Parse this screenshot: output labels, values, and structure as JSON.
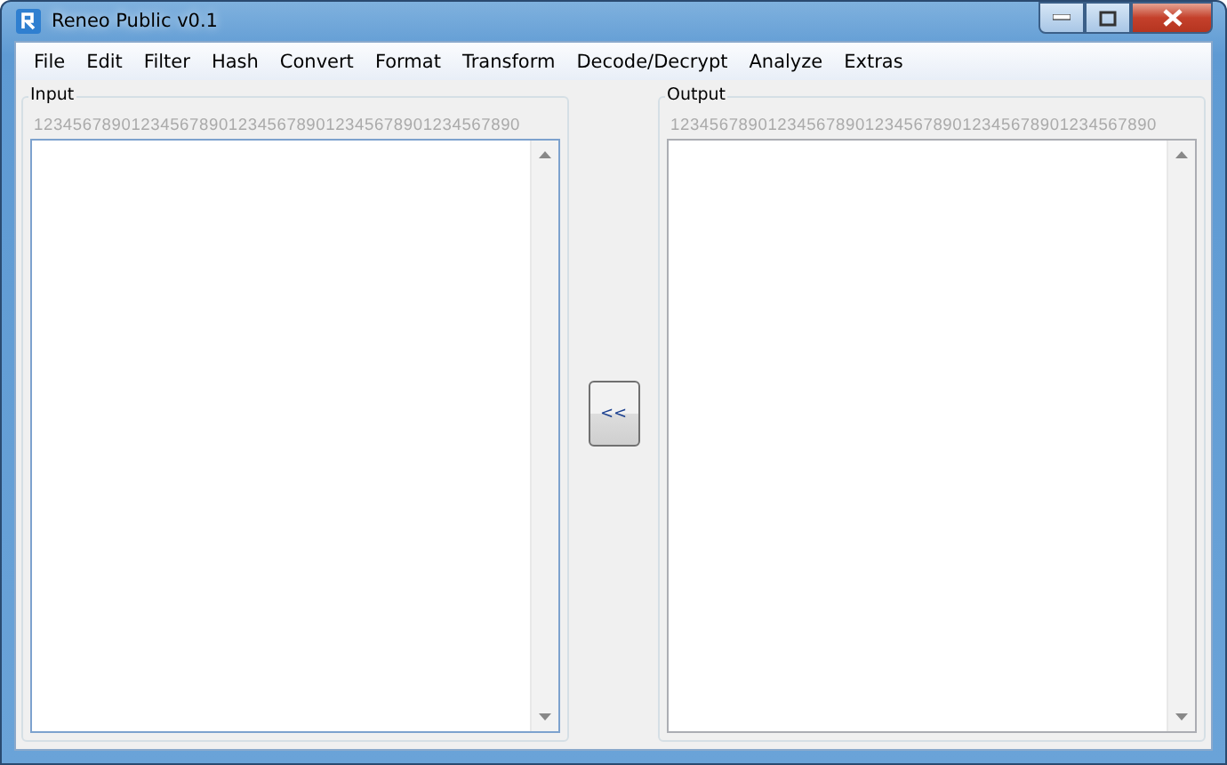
{
  "window": {
    "title": "Reneo Public v0.1"
  },
  "menu": [
    "File",
    "Edit",
    "Filter",
    "Hash",
    "Convert",
    "Format",
    "Transform",
    "Decode/Decrypt",
    "Analyze",
    "Extras"
  ],
  "panels": [
    {
      "label": "Input",
      "ruler": "12345678901234567890123456789012345678901234567890",
      "focused": true
    },
    {
      "label": "Output",
      "ruler": "12345678901234567890123456789012345678901234567890",
      "focused": false
    }
  ],
  "copy_button": {
    "label": "<<"
  }
}
